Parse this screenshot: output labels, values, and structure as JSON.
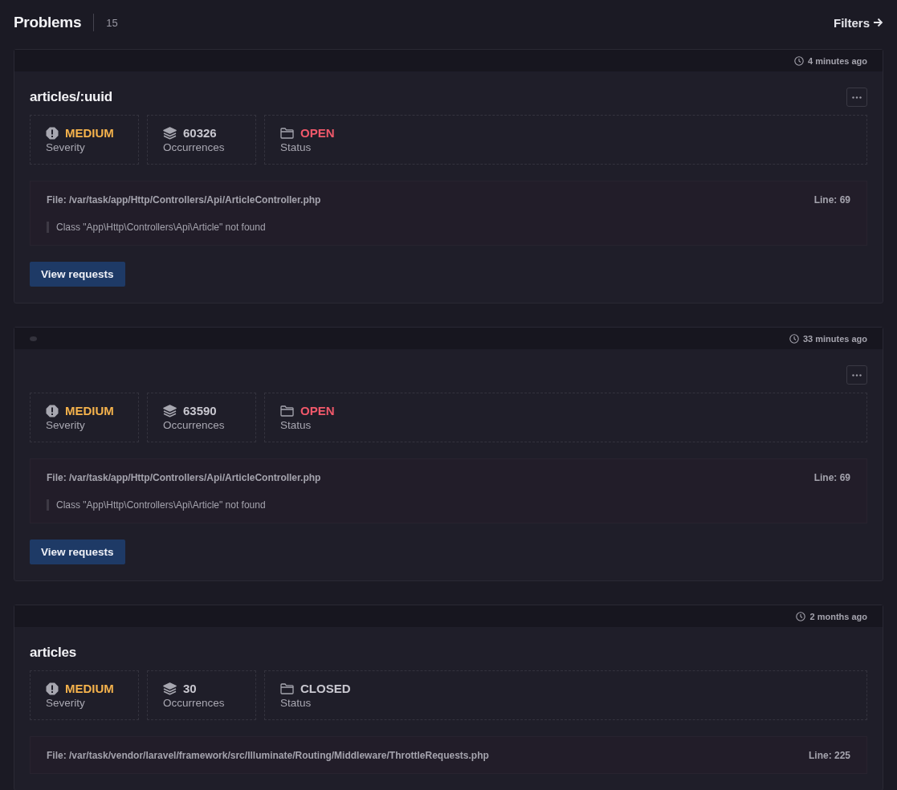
{
  "header": {
    "title": "Problems",
    "count": "15",
    "filters_link": "Filters"
  },
  "problems": [
    {
      "header_dot": false,
      "time": "4 minutes ago",
      "title": "articles/:uuid",
      "menu": true,
      "severity": {
        "value": "MEDIUM",
        "color": "#f4b24c",
        "label": "Severity"
      },
      "occurrences": {
        "value": "60326",
        "label": "Occurrences"
      },
      "status": {
        "value": "OPEN",
        "open": true,
        "label": "Status"
      },
      "file": "File: /var/task/app/Http/Controllers/Api/ArticleController.php",
      "line": "Line: 69",
      "message": "Class \"App\\Http\\Controllers\\Api\\Article\" not found",
      "button": "View requests"
    },
    {
      "header_dot": true,
      "time": "33 minutes ago",
      "menu": true,
      "severity": {
        "value": "MEDIUM",
        "color": "#f4b24c",
        "label": "Severity"
      },
      "occurrences": {
        "value": "63590",
        "label": "Occurrences"
      },
      "status": {
        "value": "OPEN",
        "open": true,
        "label": "Status"
      },
      "file": "File: /var/task/app/Http/Controllers/Api/ArticleController.php",
      "line": "Line: 69",
      "message": "Class \"App\\Http\\Controllers\\Api\\Article\" not found",
      "button": "View requests"
    },
    {
      "header_dot": false,
      "time": "2 months ago",
      "title": "articles",
      "menu": false,
      "severity": {
        "value": "MEDIUM",
        "color": "#f4b24c",
        "label": "Severity"
      },
      "occurrences": {
        "value": "30",
        "label": "Occurrences"
      },
      "status": {
        "value": "CLOSED",
        "open": false,
        "label": "Status"
      },
      "file": "File: /var/task/vendor/laravel/framework/src/Illuminate/Routing/Middleware/ThrottleRequests.php",
      "line": "Line: 225"
    }
  ]
}
